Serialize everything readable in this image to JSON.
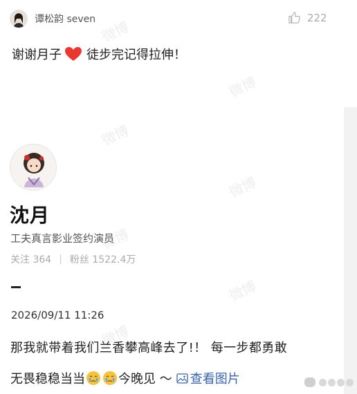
{
  "comment": {
    "username": "谭松韵 seven",
    "like_count": "222",
    "text_before": "谢谢月子",
    "text_after": "徒步完记得拉伸！"
  },
  "profile": {
    "name": "沈月",
    "bio": "工夫真言影业签约演员",
    "following_label": "关注",
    "following_count": "364",
    "followers_label": "粉丝",
    "followers_count": "1522.4万"
  },
  "post": {
    "timestamp": "2026/09/11 11:26",
    "line1": "那我就带着我们兰香攀高峰去了!！ 每一步都勇敢",
    "line2": "无畏稳稳当当",
    "line2_tail": "今晚见 ～",
    "view_images": "查看图片"
  },
  "watermark": "微博",
  "colors": {
    "link": "#3a63a8",
    "heart": "#e8382f",
    "muted": "#aaaaaa"
  }
}
